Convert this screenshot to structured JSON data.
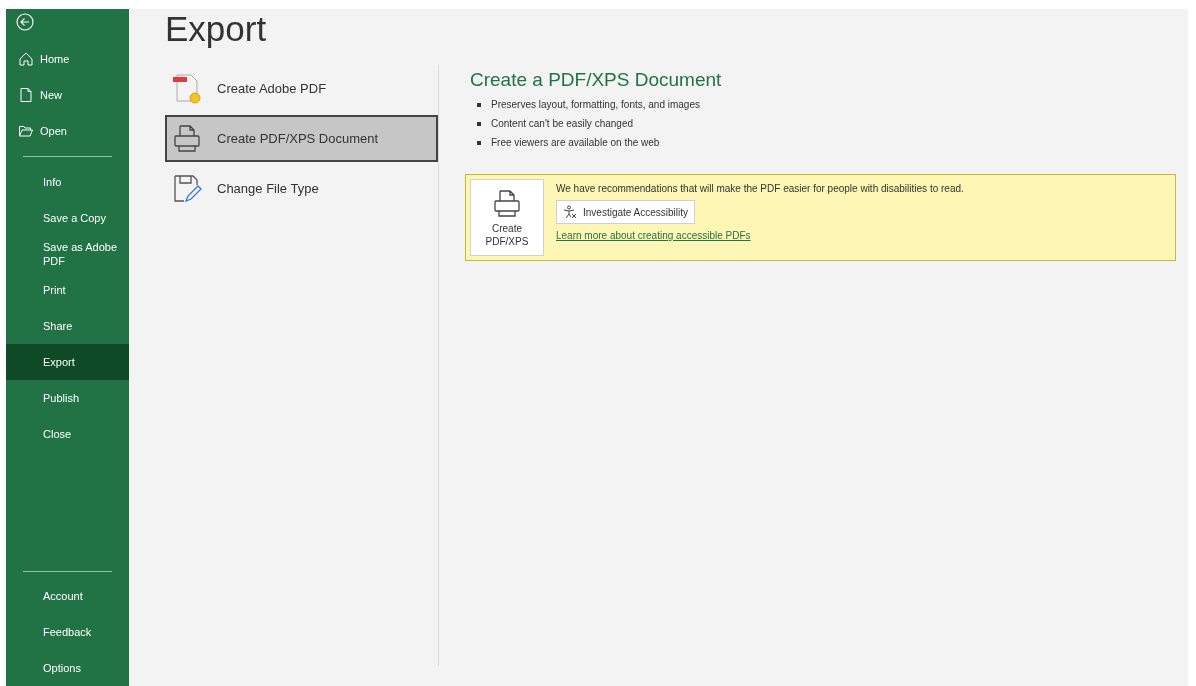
{
  "sidebar": {
    "top_items": [
      {
        "label": "Home",
        "selected": false
      },
      {
        "label": "New",
        "selected": false
      },
      {
        "label": "Open",
        "selected": false
      }
    ],
    "items": [
      {
        "label": "Info",
        "selected": false
      },
      {
        "label": "Save a Copy",
        "selected": false
      },
      {
        "label": "Save as Adobe PDF",
        "selected": false
      },
      {
        "label": "Print",
        "selected": false
      },
      {
        "label": "Share",
        "selected": false
      },
      {
        "label": "Export",
        "selected": true
      },
      {
        "label": "Publish",
        "selected": false
      },
      {
        "label": "Close",
        "selected": false
      }
    ],
    "bottom_items": [
      {
        "label": "Account",
        "selected": false
      },
      {
        "label": "Feedback",
        "selected": false
      },
      {
        "label": "Options",
        "selected": false
      }
    ]
  },
  "title": "Export",
  "options": [
    {
      "label": "Create Adobe PDF",
      "selected": false
    },
    {
      "label": "Create PDF/XPS Document",
      "selected": true
    },
    {
      "label": "Change File Type",
      "selected": false
    }
  ],
  "detail": {
    "heading": "Create a PDF/XPS Document",
    "bullets": [
      "Preserves layout, formatting, fonts, and images",
      "Content can't be easily changed",
      "Free viewers are available on the web"
    ],
    "create_button": "Create PDF/XPS",
    "notice": {
      "text": "We have recommendations that will make the PDF easier for people with disabilities to read.",
      "button": "Investigate Accessibility",
      "link": "Learn more about creating accessible PDFs"
    }
  }
}
